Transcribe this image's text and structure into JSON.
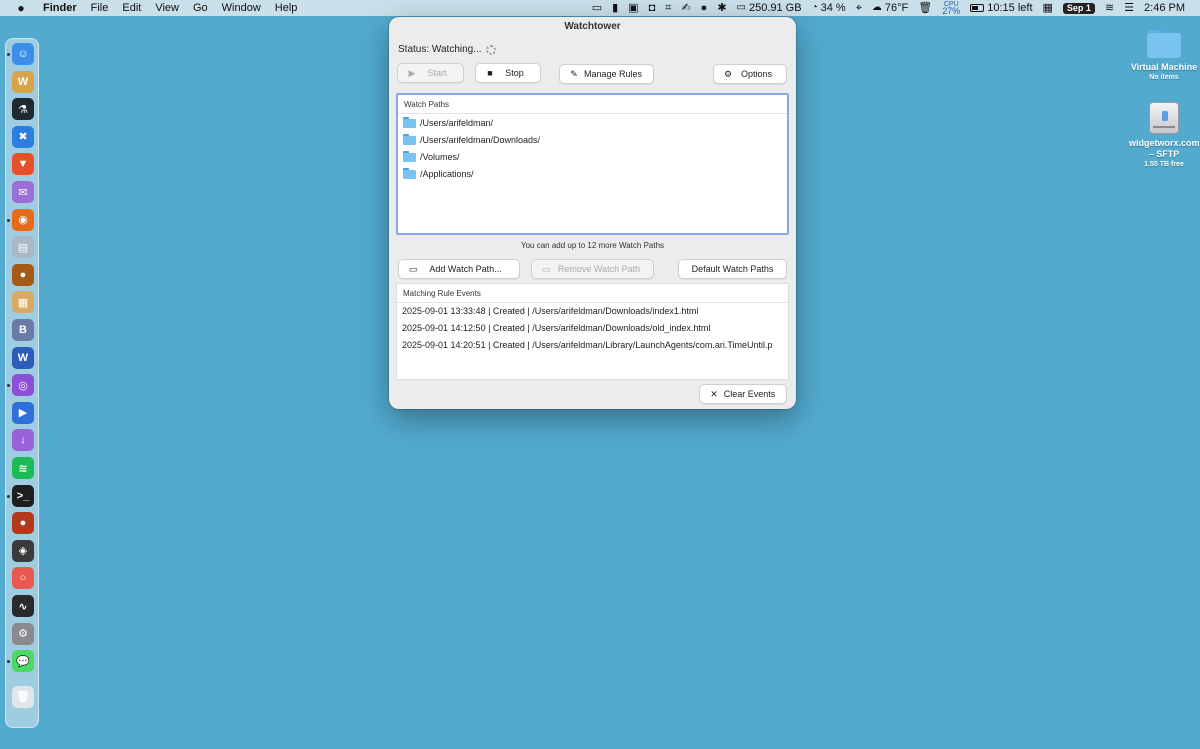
{
  "menubar": {
    "apple": "",
    "app": "Finder",
    "menus": [
      "File",
      "Edit",
      "View",
      "Go",
      "Window",
      "Help"
    ],
    "disk": "250.91 GB",
    "memory": "34 %",
    "weather": "76°F",
    "cpu_label": "CPU",
    "cpu_value": "27%",
    "battery": "10:15 left",
    "date": "Sep 1",
    "time": "2:46 PM"
  },
  "desktop": {
    "items": [
      {
        "label": "Virtual Machine",
        "sub": "No items"
      },
      {
        "label": "widgetworx.com – SFTP",
        "sub": "1.55 TB free"
      }
    ]
  },
  "dock": {
    "icons": [
      {
        "name": "finder-icon",
        "color": "#3d8ee8",
        "glyph": "☺"
      },
      {
        "name": "word-doc-icon",
        "color": "#d8a44a",
        "glyph": "W"
      },
      {
        "name": "lab-flask-icon",
        "color": "#1f2a30",
        "glyph": "⚗"
      },
      {
        "name": "xcode-tools-icon",
        "color": "#2c7fe0",
        "glyph": "✖"
      },
      {
        "name": "brave-icon",
        "color": "#e8502a",
        "glyph": "▼"
      },
      {
        "name": "mail-icon",
        "color": "#9c6fd8",
        "glyph": "✉"
      },
      {
        "name": "firefox-icon",
        "color": "#e66a1c",
        "glyph": "◉"
      },
      {
        "name": "scanner-icon",
        "color": "#a9b7c6",
        "glyph": "▤"
      },
      {
        "name": "acorn-icon",
        "color": "#a55a18",
        "glyph": "●"
      },
      {
        "name": "preview-icon",
        "color": "#d8ab62",
        "glyph": "▦"
      },
      {
        "name": "bbedit-icon",
        "color": "#6c7aa8",
        "glyph": "B"
      },
      {
        "name": "word-icon",
        "color": "#2b5cb8",
        "glyph": "W"
      },
      {
        "name": "colorsync-icon",
        "color": "#8c4fd8",
        "glyph": "◎"
      },
      {
        "name": "infuse-icon",
        "color": "#2f6fd8",
        "glyph": "▶"
      },
      {
        "name": "downloader-icon",
        "color": "#9a62d8",
        "glyph": "↓"
      },
      {
        "name": "spotify-icon",
        "color": "#1db954",
        "glyph": "≋"
      },
      {
        "name": "terminal-icon",
        "color": "#1e1e1e",
        "glyph": ">_"
      },
      {
        "name": "coffee-icon",
        "color": "#b23a1a",
        "glyph": "●"
      },
      {
        "name": "virtualbox-icon",
        "color": "#3a3a3a",
        "glyph": "◈"
      },
      {
        "name": "ring-app-icon",
        "color": "#e85a50",
        "glyph": "○"
      },
      {
        "name": "activity-monitor-icon",
        "color": "#2a2a2a",
        "glyph": "∿"
      },
      {
        "name": "system-settings-icon",
        "color": "#8a8a8e",
        "glyph": "⚙"
      },
      {
        "name": "messages-icon",
        "color": "#4cd964",
        "glyph": "💬"
      },
      {
        "name": "trash-icon",
        "color": "#dfe6ea",
        "glyph": "🗑"
      }
    ]
  },
  "window": {
    "title": "Watchtower",
    "status": "Status: Watching...",
    "toolbar": {
      "start": "Start",
      "stop": "Stop",
      "manage_rules": "Manage Rules",
      "options": "Options"
    },
    "watch_paths": {
      "header": "Watch Paths",
      "items": [
        "/Users/arifeldman/",
        "/Users/arifeldman/Downloads/",
        "/Volumes/",
        "/Applications/"
      ],
      "hint": "You can add up to 12 more Watch Paths"
    },
    "path_buttons": {
      "add": "Add Watch Path...",
      "remove": "Remove Watch Path",
      "default": "Default Watch Paths"
    },
    "events": {
      "header": "Matching Rule Events",
      "items": [
        "2025-09-01 13:33:48 | Created | /Users/arifeldman/Downloads/index1.html",
        "2025-09-01 14:12:50 | Created | /Users/arifeldman/Downloads/old_index.html",
        "2025-09-01 14:20:51 | Created | /Users/arifeldman/Library/LaunchAgents/com.ari.TimeUntil.p"
      ]
    },
    "clear_events": "Clear Events"
  }
}
